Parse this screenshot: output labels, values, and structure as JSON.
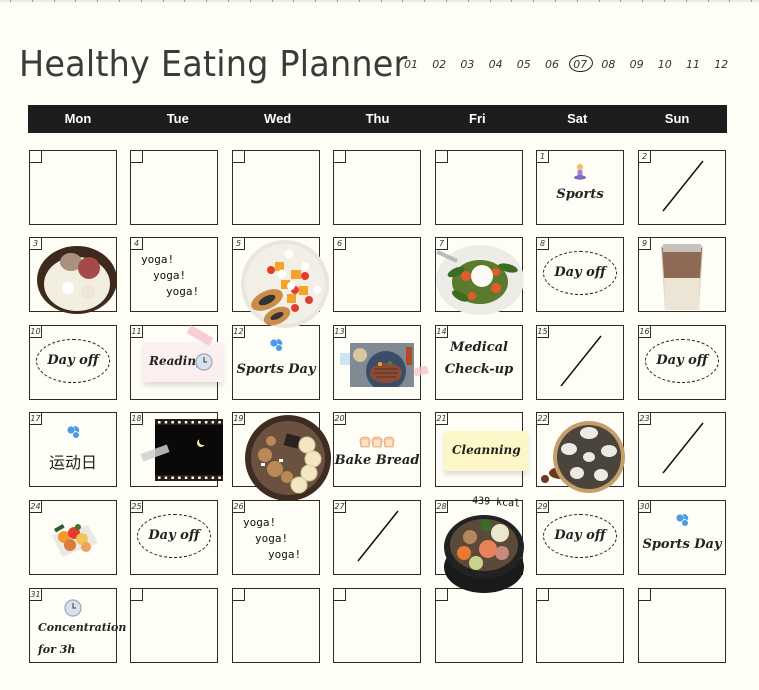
{
  "header": {
    "title": "Healthy Eating Planner"
  },
  "months": {
    "items": [
      "01",
      "02",
      "03",
      "04",
      "05",
      "06",
      "07",
      "08",
      "09",
      "10",
      "11",
      "12"
    ],
    "selected": "07"
  },
  "weekdays": [
    "Mon",
    "Tue",
    "Wed",
    "Thu",
    "Fri",
    "Sat",
    "Sun"
  ],
  "calendar": {
    "cells": [
      {
        "day": "",
        "type": "empty"
      },
      {
        "day": "",
        "type": "empty"
      },
      {
        "day": "",
        "type": "empty"
      },
      {
        "day": "",
        "type": "empty"
      },
      {
        "day": "",
        "type": "empty"
      },
      {
        "day": "1",
        "type": "note",
        "icon": "person-in-lotus-position-icon",
        "text": "Sports"
      },
      {
        "day": "2",
        "type": "slash"
      },
      {
        "day": "3",
        "type": "photo",
        "photo": "rice-bowl-photo"
      },
      {
        "day": "4",
        "type": "yoga",
        "lines": [
          "yoga!",
          "yoga!",
          "yoga!"
        ]
      },
      {
        "day": "5",
        "type": "photo",
        "photo": "fruit-plate-photo"
      },
      {
        "day": "6",
        "type": "blank"
      },
      {
        "day": "7",
        "type": "photo",
        "photo": "burrata-salad-photo"
      },
      {
        "day": "8",
        "type": "dayoff",
        "text": "Day off"
      },
      {
        "day": "9",
        "type": "photo",
        "photo": "iced-latte-photo"
      },
      {
        "day": "10",
        "type": "dayoff",
        "text": "Day off"
      },
      {
        "day": "11",
        "type": "sticky-pink",
        "text": "Reading",
        "icon": "clock-icon"
      },
      {
        "day": "12",
        "type": "note",
        "icon": "sweat-droplets-icon",
        "text": "Sports Day"
      },
      {
        "day": "13",
        "type": "photo",
        "photo": "steak-dinner-photo"
      },
      {
        "day": "14",
        "type": "multiline",
        "lines": [
          "Medical",
          "Check-up"
        ]
      },
      {
        "day": "15",
        "type": "slash"
      },
      {
        "day": "16",
        "type": "dayoff",
        "text": "Day off"
      },
      {
        "day": "17",
        "type": "note",
        "icon": "sweat-droplets-icon",
        "text": "运动日"
      },
      {
        "day": "18",
        "type": "photo",
        "photo": "night-moon-film-photo"
      },
      {
        "day": "19",
        "type": "photo",
        "photo": "granola-banana-bowl-photo"
      },
      {
        "day": "20",
        "type": "note",
        "icon": "bread-icon",
        "text": "Bake Bread"
      },
      {
        "day": "21",
        "type": "sticky-yellow",
        "text": "Cleanning"
      },
      {
        "day": "22",
        "type": "photo",
        "photo": "mushroom-pizza-photo"
      },
      {
        "day": "23",
        "type": "slash"
      },
      {
        "day": "24",
        "type": "photo",
        "photo": "vegetable-box-photo"
      },
      {
        "day": "25",
        "type": "dayoff",
        "text": "Day off"
      },
      {
        "day": "26",
        "type": "yoga",
        "lines": [
          "yoga!",
          "yoga!",
          "yoga!"
        ]
      },
      {
        "day": "27",
        "type": "slash"
      },
      {
        "day": "28",
        "type": "photo",
        "photo": "bibimbap-photo",
        "caption": "439 kcal"
      },
      {
        "day": "29",
        "type": "dayoff",
        "text": "Day off"
      },
      {
        "day": "30",
        "type": "note",
        "icon": "sweat-droplets-icon",
        "text": "Sports Day"
      },
      {
        "day": "31",
        "type": "multiline",
        "icon": "clock-icon",
        "lines": [
          "Concentration",
          "for 3h"
        ]
      },
      {
        "day": "",
        "type": "empty"
      },
      {
        "day": "",
        "type": "empty"
      },
      {
        "day": "",
        "type": "empty"
      },
      {
        "day": "",
        "type": "empty"
      },
      {
        "day": "",
        "type": "empty"
      },
      {
        "day": "",
        "type": "empty"
      }
    ]
  },
  "colors": {
    "background": "#fefef6",
    "header_bar": "#1d1d1d",
    "accent_blue": "#4a9be8",
    "sticky_pink": "#fcefef",
    "sticky_yellow": "#fdf6c6"
  }
}
